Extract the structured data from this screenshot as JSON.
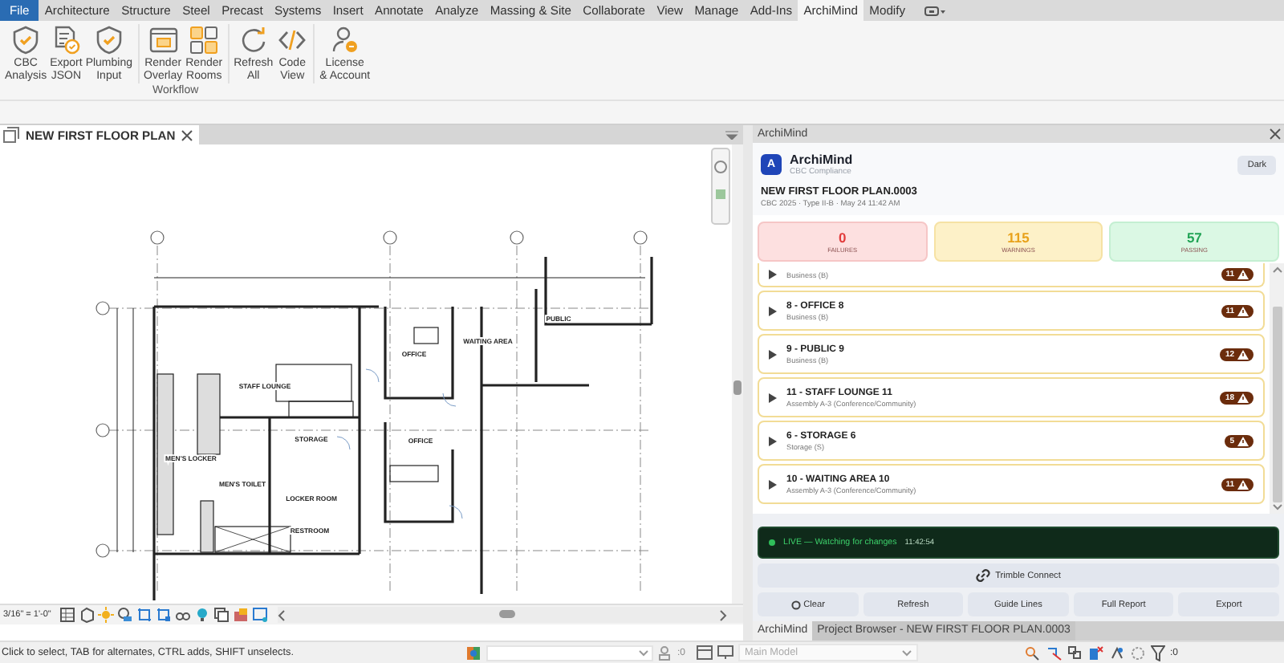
{
  "menu_tabs": [
    {
      "label": "File",
      "kind": "file",
      "selected": false
    },
    {
      "label": "Architecture",
      "kind": "tab",
      "selected": false
    },
    {
      "label": "Structure",
      "kind": "tab",
      "selected": false
    },
    {
      "label": "Steel",
      "kind": "tab",
      "selected": false
    },
    {
      "label": "Precast",
      "kind": "tab",
      "selected": false
    },
    {
      "label": "Systems",
      "kind": "tab",
      "selected": false
    },
    {
      "label": "Insert",
      "kind": "tab",
      "selected": false
    },
    {
      "label": "Annotate",
      "kind": "tab",
      "selected": false
    },
    {
      "label": "Analyze",
      "kind": "tab",
      "selected": false
    },
    {
      "label": "Massing & Site",
      "kind": "tab",
      "selected": false
    },
    {
      "label": "Collaborate",
      "kind": "tab",
      "selected": false
    },
    {
      "label": "View",
      "kind": "tab",
      "selected": false
    },
    {
      "label": "Manage",
      "kind": "tab",
      "selected": false
    },
    {
      "label": "Add-Ins",
      "kind": "tab",
      "selected": false
    },
    {
      "label": "ArchiMind",
      "kind": "tab",
      "selected": true
    },
    {
      "label": "Modify",
      "kind": "tab",
      "selected": false
    }
  ],
  "ribbon": {
    "groups": [
      {
        "buttons": [
          {
            "label": "CBC\nAnalysis"
          },
          {
            "label": "Export\nJSON"
          },
          {
            "label": "Plumbing\nInput"
          }
        ]
      },
      {
        "buttons": [
          {
            "label": "Render\nOverlay"
          },
          {
            "label": "Render\nRooms"
          }
        ]
      },
      {
        "buttons": [
          {
            "label": "Refresh\nAll"
          },
          {
            "label": "Code\nView"
          }
        ]
      },
      {
        "buttons": [
          {
            "label": "License\n& Account"
          }
        ]
      }
    ],
    "panel_label": "Workflow"
  },
  "view": {
    "tab_title": "NEW FIRST FLOOR PLAN",
    "room_labels": [
      "STAFF LOUNGE",
      "OFFICE",
      "WAITING AREA",
      "PUBLIC",
      "STORAGE",
      "OFFICE",
      "MEN'S LOCKER",
      "MEN'S TOILET",
      "LOCKER ROOM",
      "RESTROOM"
    ],
    "scale": "3/16\" = 1'-0\""
  },
  "panel": {
    "title": "ArchiMind",
    "app": {
      "logo": "A",
      "name": "ArchiMind",
      "subtitle": "CBC Compliance",
      "theme_button": "Dark"
    },
    "document": {
      "title": "NEW FIRST FLOOR PLAN.0003",
      "meta": "CBC 2025 · Type II-B · May 24 11:42 AM"
    },
    "stats": [
      {
        "value": "0",
        "label": "FAILURES",
        "kind": "fail"
      },
      {
        "value": "115",
        "label": "WARNINGS",
        "kind": "warn"
      },
      {
        "value": "57",
        "label": "PASSING",
        "kind": "pass"
      }
    ],
    "rooms": [
      {
        "subtitle": "Business (B)",
        "count": "11"
      },
      {
        "title": "8 - OFFICE 8",
        "subtitle": "Business (B)",
        "count": "11"
      },
      {
        "title": "9 - PUBLIC 9",
        "subtitle": "Business (B)",
        "count": "12"
      },
      {
        "title": "11 - STAFF LOUNGE 11",
        "subtitle": "Assembly A-3 (Conference/Community)",
        "count": "18"
      },
      {
        "title": "6 - STORAGE 6",
        "subtitle": "Storage (S)",
        "count": "5"
      },
      {
        "title": "10 - WAITING AREA 10",
        "subtitle": "Assembly A-3 (Conference/Community)",
        "count": "11"
      }
    ],
    "live": {
      "label": "LIVE — Watching for changes",
      "time": "11:42:54"
    },
    "connect_button": "Trimble Connect",
    "actions": [
      {
        "label": "Clear",
        "kind": "clear"
      },
      {
        "label": "Refresh",
        "kind": "plain"
      },
      {
        "label": "Guide Lines",
        "kind": "plain"
      },
      {
        "label": "Full Report",
        "kind": "plain"
      },
      {
        "label": "Export",
        "kind": "plain"
      }
    ],
    "tabs": [
      {
        "label": "ArchiMind",
        "selected": true
      },
      {
        "label": "Project Browser - NEW FIRST FLOOR PLAN.0003",
        "selected": false
      }
    ]
  },
  "status_bar": {
    "message": "Click to select, TAB for alternates, CTRL adds, SHIFT unselects.",
    "select_count": ":0",
    "model": "Main Model",
    "filter_count": ":0"
  }
}
